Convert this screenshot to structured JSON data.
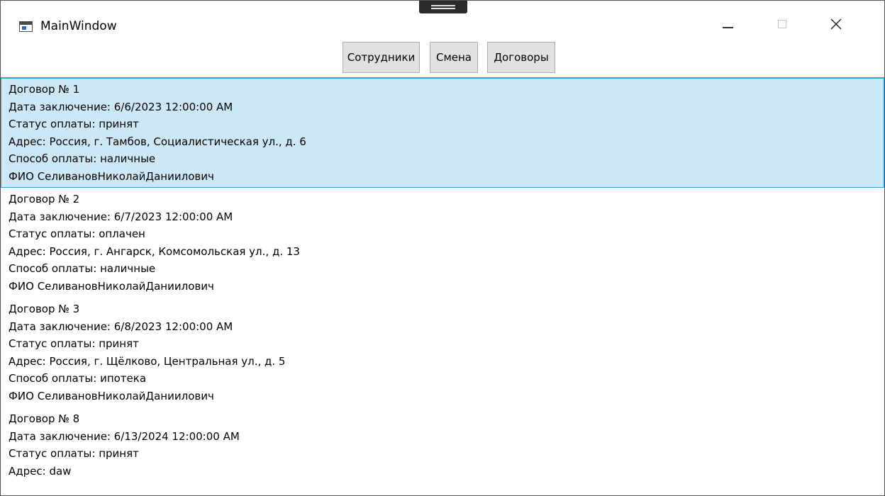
{
  "window": {
    "title": "MainWindow"
  },
  "toolbar": {
    "employees_label": "Сотрудники",
    "shift_label": "Смена",
    "contracts_label": "Договоры"
  },
  "colors": {
    "selection_background": "#cce8f6",
    "selection_border": "#26a0da",
    "button_background": "#e1e1e1"
  },
  "contracts": [
    {
      "title": "Договор № 1",
      "date": "Дата заключение: 6/6/2023 12:00:00 AM",
      "status": "Статус оплаты: принят",
      "address": "Адрес: Россия, г. Тамбов, Социалистическая ул., д. 6",
      "payment_method": "Способ оплаты: наличные",
      "person": "ФИО СеливановНиколайДаниилович",
      "selected": true
    },
    {
      "title": "Договор № 2",
      "date": "Дата заключение: 6/7/2023 12:00:00 AM",
      "status": "Статус оплаты: оплачен",
      "address": "Адрес: Россия, г. Ангарск, Комсомольская ул., д. 13",
      "payment_method": "Способ оплаты: наличные",
      "person": "ФИО СеливановНиколайДаниилович",
      "selected": false
    },
    {
      "title": "Договор № 3",
      "date": "Дата заключение: 6/8/2023 12:00:00 AM",
      "status": "Статус оплаты: принят",
      "address": "Адрес: Россия, г. Щёлково, Центральная ул., д. 5",
      "payment_method": "Способ оплаты: ипотека",
      "person": "ФИО СеливановНиколайДаниилович",
      "selected": false
    },
    {
      "title": "Договор № 8",
      "date": "Дата заключение: 6/13/2024 12:00:00 AM",
      "status": "Статус оплаты: принят",
      "address": "Адрес: daw",
      "payment_method": "",
      "person": "",
      "selected": false
    }
  ]
}
